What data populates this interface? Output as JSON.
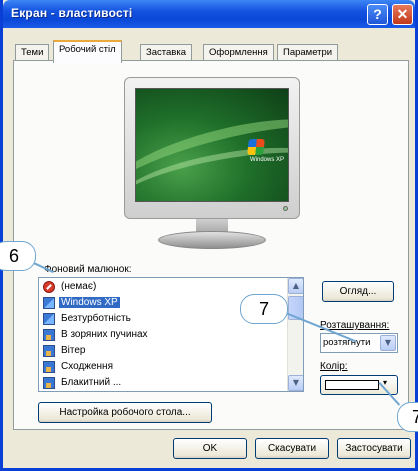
{
  "window": {
    "title": "Екран - властивості",
    "help_button": "?",
    "close_button": "✕"
  },
  "tabs": [
    {
      "label": "Теми",
      "active": false
    },
    {
      "label": "Робочий стіл",
      "active": true
    },
    {
      "label": "Заставка",
      "active": false
    },
    {
      "label": "Оформлення",
      "active": false
    },
    {
      "label": "Параметри",
      "active": false
    }
  ],
  "preview": {
    "logo_text": "Windows XP"
  },
  "background": {
    "label": "Фоновий малюнок:",
    "items": [
      {
        "label": "(немає)",
        "icon": "no-entry-icon",
        "selected": false
      },
      {
        "label": "Windows XP",
        "icon": "image-icon",
        "selected": true
      },
      {
        "label": "Безтурботність",
        "icon": "image-icon",
        "selected": false
      },
      {
        "label": "В зоряних пучинах",
        "icon": "picture-icon",
        "selected": false
      },
      {
        "label": "Вітер",
        "icon": "picture-icon",
        "selected": false
      },
      {
        "label": "Сходження",
        "icon": "picture-icon",
        "selected": false
      },
      {
        "label": "Блакитний ...",
        "icon": "picture-icon",
        "selected": false
      }
    ],
    "browse_button": "Огляд...",
    "position_label": "Розташування:",
    "position_value": "розтягнути",
    "color_label": "Колір:",
    "color_value": "#ffffff",
    "desktop_button": "Настройка робочого стола..."
  },
  "buttons": {
    "ok": "OK",
    "cancel": "Скасувати",
    "apply": "Застосувати"
  },
  "callouts": {
    "c6": "6",
    "c7": "7",
    "c7b": "7"
  },
  "colors": {
    "title_bar": "#0a48d9",
    "selection": "#316ac5",
    "callout_border": "#6fa6d2"
  }
}
